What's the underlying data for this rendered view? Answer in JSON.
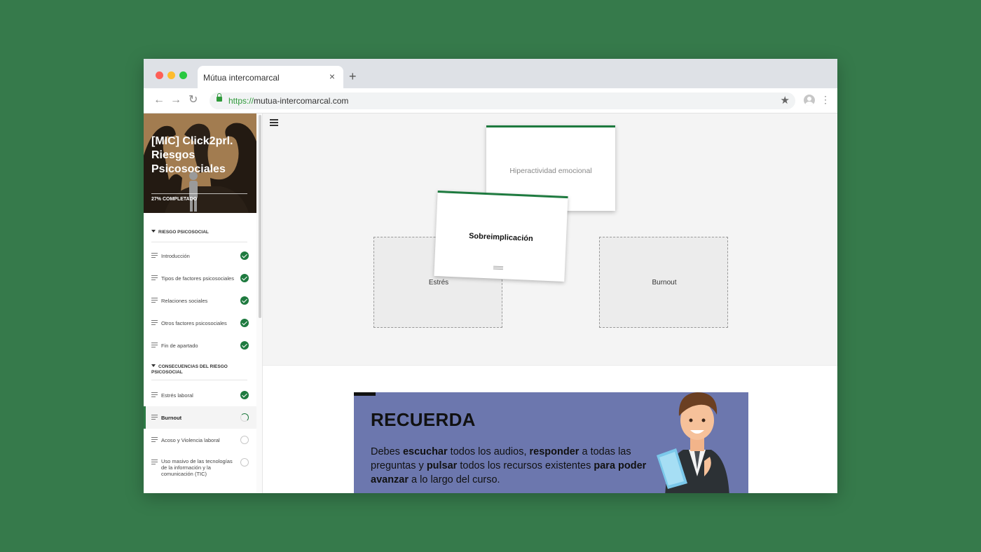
{
  "browser": {
    "tab_title": "Mútua intercomarcal",
    "url_protocol": "https://",
    "url_host": "mutua-intercomarcal.com"
  },
  "course": {
    "title": "[MIC] Click2prl. Riesgos Psicosociales",
    "progress_text": "27% COMPLETADO"
  },
  "sections": [
    {
      "title": "RIESGO PSICOSOCIAL",
      "lessons": [
        {
          "label": "Introducción",
          "status": "done"
        },
        {
          "label": "Tipos de factores psicosociales",
          "status": "done"
        },
        {
          "label": "Relaciones sociales",
          "status": "done"
        },
        {
          "label": "Otros factores psicosociales",
          "status": "done"
        },
        {
          "label": "Fin de apartado",
          "status": "done"
        }
      ]
    },
    {
      "title": "CONSECUENCIAS DEL RIESGO PSICOSOCIAL",
      "lessons": [
        {
          "label": "Estrés laboral",
          "status": "done"
        },
        {
          "label": "Burnout",
          "status": "in-progress"
        },
        {
          "label": "Acoso y Violencia laboral",
          "status": "not-started"
        },
        {
          "label": "Uso masivo de las tecnologías de la información y la comunicación (TIC)",
          "status": "not-started"
        }
      ]
    }
  ],
  "activity": {
    "cards": [
      "Hiperactividad emocional",
      "Sobreimplicación"
    ],
    "dropzones": [
      "Estrés",
      "Burnout"
    ]
  },
  "reminder": {
    "title": "RECUERDA",
    "text_1": "Debes ",
    "text_2": "escuchar",
    "text_3": " todos los audios, ",
    "text_4": "responder",
    "text_5": " a todas las preguntas y ",
    "text_6": "pulsar",
    "text_7": " todos los recursos existentes ",
    "text_8": "para poder avanzar",
    "text_9": " a lo largo del curso."
  },
  "colors": {
    "page_bg": "#367a4b",
    "accent_green": "#1e7a3f",
    "banner_bg": "#6c77ae",
    "hero_bg": "#a27c50"
  }
}
